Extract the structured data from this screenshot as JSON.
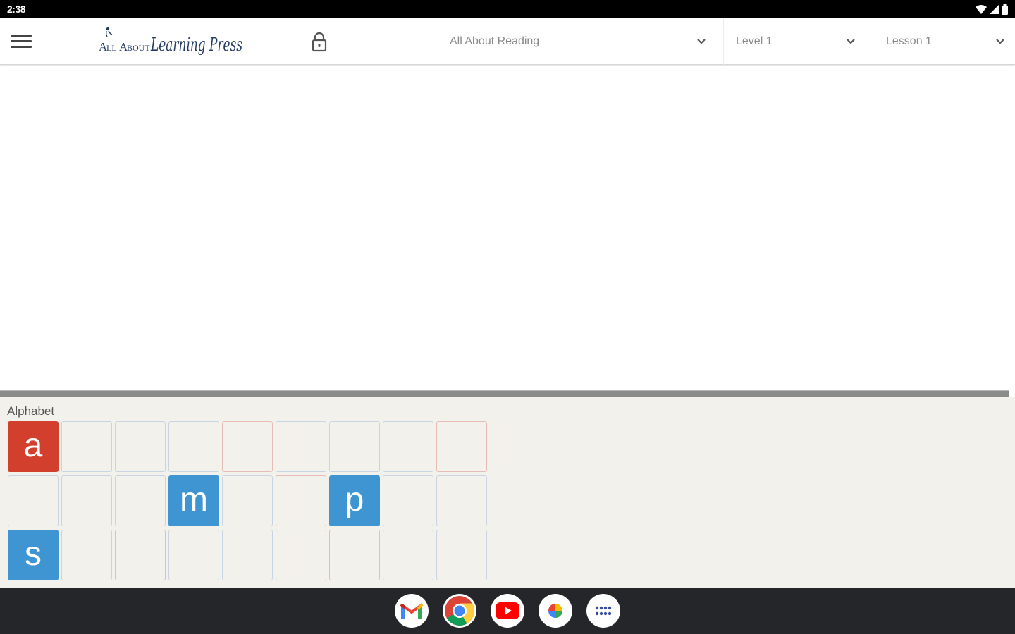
{
  "status_bar": {
    "time": "2:38"
  },
  "header": {
    "logo_text": "All About Learning Press",
    "dropdowns": {
      "program": "All About Reading",
      "level": "Level 1",
      "lesson": "Lesson 1"
    }
  },
  "tray": {
    "title": "Alphabet",
    "tiles": [
      {
        "letter": "a",
        "color": "#d23f2c"
      },
      {
        "letter": "",
        "border": "blue"
      },
      {
        "letter": "",
        "border": "blue"
      },
      {
        "letter": "",
        "border": "blue"
      },
      {
        "letter": "",
        "border": "pink"
      },
      {
        "letter": "",
        "border": "blue"
      },
      {
        "letter": "",
        "border": "blue"
      },
      {
        "letter": "",
        "border": "blue"
      },
      {
        "letter": "",
        "border": "pink"
      },
      {
        "letter": "",
        "border": "blue"
      },
      {
        "letter": "",
        "border": "blue"
      },
      {
        "letter": "",
        "border": "blue"
      },
      {
        "letter": "m",
        "color": "#3f95d1"
      },
      {
        "letter": "",
        "border": "blue"
      },
      {
        "letter": "",
        "border": "pink"
      },
      {
        "letter": "p",
        "color": "#3f95d1"
      },
      {
        "letter": "",
        "border": "blue"
      },
      {
        "letter": "",
        "border": "blue"
      },
      {
        "letter": "s",
        "color": "#3f95d1"
      },
      {
        "letter": "",
        "border": "blue"
      },
      {
        "letter": "",
        "border": "pink"
      },
      {
        "letter": "",
        "border": "blue"
      },
      {
        "letter": "",
        "border": "blue"
      },
      {
        "letter": "",
        "border": "blue"
      },
      {
        "letter": "",
        "border": "pink"
      },
      {
        "letter": "",
        "border": "blue"
      },
      {
        "letter": "",
        "border": "blue"
      }
    ]
  },
  "taskbar": {
    "apps": [
      "gmail-icon",
      "chrome-icon",
      "youtube-icon",
      "photos-icon",
      "app-drawer-icon"
    ]
  }
}
